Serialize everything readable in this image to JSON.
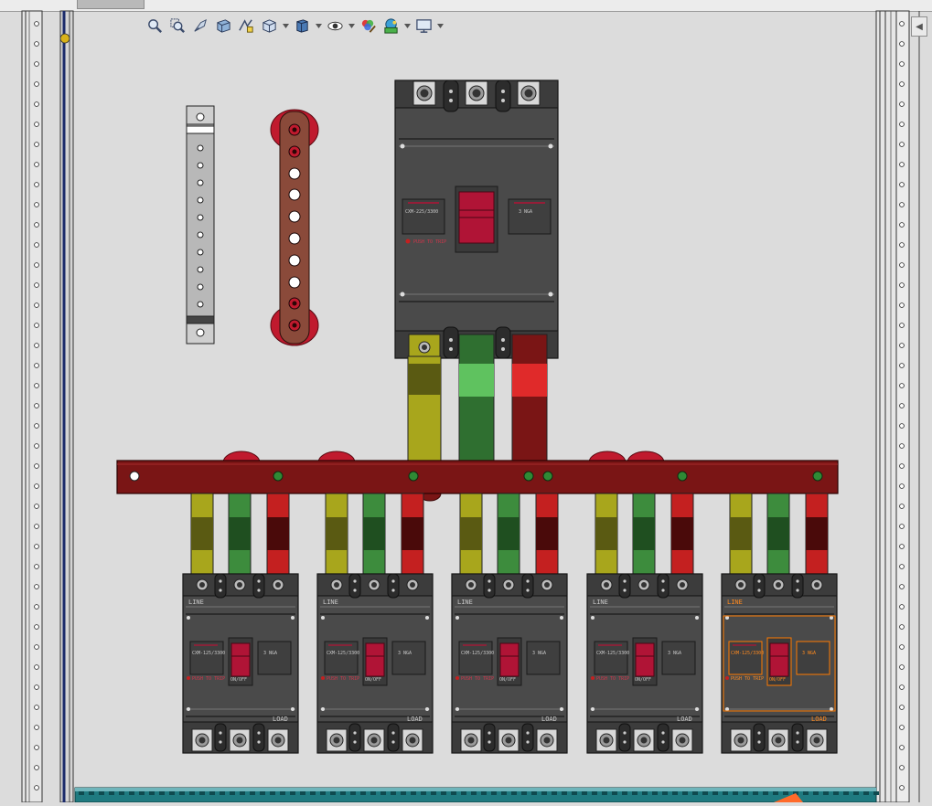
{
  "toolbar": {
    "items": [
      {
        "name": "zoom-to-fit-icon",
        "dropdown": false
      },
      {
        "name": "zoom-to-area-icon",
        "dropdown": false
      },
      {
        "name": "previous-view-icon",
        "dropdown": false
      },
      {
        "name": "section-view-icon",
        "dropdown": false
      },
      {
        "name": "dynamic-annotation-icon",
        "dropdown": false
      },
      {
        "name": "view-orientation-icon",
        "dropdown": true
      },
      {
        "name": "display-style-icon",
        "dropdown": true
      },
      {
        "name": "hide-show-items-icon",
        "dropdown": true
      },
      {
        "name": "edit-appearance-icon",
        "dropdown": false
      },
      {
        "name": "apply-scene-icon",
        "dropdown": true
      },
      {
        "name": "view-settings-icon",
        "dropdown": true
      }
    ]
  },
  "model": {
    "main_breaker": {
      "line_label": "",
      "type_label": "CXM-225/3300",
      "rating_label": "3 NGA",
      "push_to_trip": "PUSH TO TRIP",
      "phase_colors": [
        "#a8a61c",
        "#3d8c3d",
        "#c42020"
      ]
    },
    "branch_breakers": [
      {
        "line_label": "LINE",
        "load_label": "LOAD",
        "type_label": "CXM-125/3300",
        "rating_label": "3 NGA",
        "push_to_trip": "PUSH TO TRIP",
        "handle_label": "ON/OFF",
        "selected": false
      },
      {
        "line_label": "LINE",
        "load_label": "LOAD",
        "type_label": "CXM-125/3300",
        "rating_label": "3 NGA",
        "push_to_trip": "PUSH TO TRIP",
        "handle_label": "ON/OFF",
        "selected": false
      },
      {
        "line_label": "LINE",
        "load_label": "LOAD",
        "type_label": "CXM-125/3300",
        "rating_label": "3 NGA",
        "push_to_trip": "PUSH TO TRIP",
        "handle_label": "ON/OFF",
        "selected": false
      },
      {
        "line_label": "LINE",
        "load_label": "LOAD",
        "type_label": "CXM-125/3300",
        "rating_label": "3 NGA",
        "push_to_trip": "PUSH TO TRIP",
        "handle_label": "ON/OFF",
        "selected": false
      },
      {
        "line_label": "LINE",
        "load_label": "LOAD",
        "type_label": "CXM-125/3300",
        "rating_label": "3 NGA",
        "push_to_trip": "PUSH TO TRIP",
        "handle_label": "ON/OFF",
        "selected": true
      }
    ],
    "colors": {
      "background": "#dcdcdc",
      "breaker_body": "#4a4a4a",
      "busbar": "#7a1515",
      "neutral_bar": "#8a4a3a",
      "ground_bar": "#b8b8b8",
      "phase_l1": "#a8a61c",
      "phase_l2": "#3d8c3d",
      "phase_l3": "#c42020",
      "handle": "#b01436",
      "selection": "#ff7a00"
    }
  }
}
